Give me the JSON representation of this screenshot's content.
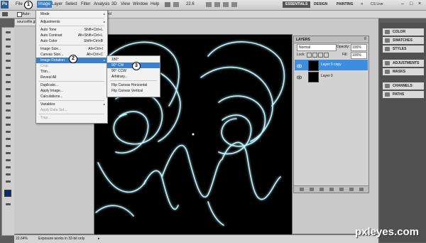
{
  "menubar": {
    "logo": "Ps",
    "items": [
      "File",
      "Image",
      "Layer",
      "Select",
      "Filter",
      "Analysis",
      "3D",
      "View",
      "Window",
      "Help"
    ],
    "zoom": "22.6",
    "workspaces": [
      "ESSENTIALS",
      "DESIGN",
      "PAINTING"
    ],
    "live": "CS Live"
  },
  "options": {
    "auto": "Auto-",
    "extra": "trol"
  },
  "doc": {
    "tab": "sourcefile.jp"
  },
  "steps": [
    "1",
    "2",
    "3"
  ],
  "image_menu": {
    "items": [
      {
        "label": "Mode",
        "shortcut": "",
        "arrow": true,
        "state": "normal"
      },
      {
        "label": "Adjustments",
        "shortcut": "",
        "arrow": true,
        "state": "normal"
      },
      {
        "label": "Auto Tone",
        "shortcut": "Shift+Ctrl+L",
        "arrow": false,
        "state": "normal"
      },
      {
        "label": "Auto Contrast",
        "shortcut": "Alt+Shift+Ctrl+L",
        "arrow": false,
        "state": "normal"
      },
      {
        "label": "Auto Color",
        "shortcut": "Shift+Ctrl+B",
        "arrow": false,
        "state": "normal"
      },
      {
        "label": "Image Size...",
        "shortcut": "Alt+Ctrl+I",
        "arrow": false,
        "state": "normal"
      },
      {
        "label": "Canvas Size...",
        "shortcut": "Alt+Ctrl+C",
        "arrow": false,
        "state": "normal"
      },
      {
        "label": "Image Rotation",
        "shortcut": "",
        "arrow": true,
        "state": "highlight"
      },
      {
        "label": "Crop",
        "shortcut": "",
        "arrow": false,
        "state": "disabled"
      },
      {
        "label": "Trim...",
        "shortcut": "",
        "arrow": false,
        "state": "normal"
      },
      {
        "label": "Reveal All",
        "shortcut": "",
        "arrow": false,
        "state": "normal"
      },
      {
        "label": "Duplicate...",
        "shortcut": "",
        "arrow": false,
        "state": "normal"
      },
      {
        "label": "Apply Image...",
        "shortcut": "",
        "arrow": false,
        "state": "normal"
      },
      {
        "label": "Calculations...",
        "shortcut": "",
        "arrow": false,
        "state": "normal"
      },
      {
        "label": "Variables",
        "shortcut": "",
        "arrow": true,
        "state": "normal"
      },
      {
        "label": "Apply Data Set...",
        "shortcut": "",
        "arrow": false,
        "state": "disabled"
      },
      {
        "label": "Trap...",
        "shortcut": "",
        "arrow": false,
        "state": "disabled"
      }
    ]
  },
  "rotation_menu": {
    "items": [
      {
        "label": "180°",
        "state": "normal"
      },
      {
        "label": "90° CW",
        "state": "highlight"
      },
      {
        "label": "90° CCW",
        "state": "normal"
      },
      {
        "label": "Arbitrary...",
        "state": "normal"
      },
      {
        "label": "Flip Canvas Horizontal",
        "state": "normal"
      },
      {
        "label": "Flip Canvas Vertical",
        "state": "normal"
      }
    ]
  },
  "layers_panel": {
    "title": "LAYERS",
    "blend_mode": "Normal",
    "opacity_label": "Opacity:",
    "opacity": "100%",
    "lock_label": "Lock:",
    "fill_label": "Fill:",
    "fill": "100%",
    "layers": [
      {
        "name": "Layer 0 copy",
        "selected": true
      },
      {
        "name": "Layer 0",
        "selected": false
      }
    ]
  },
  "side_panels": [
    "COLOR",
    "SWATCHES",
    "STYLES",
    "ADJUSTMENTS",
    "MASKS",
    "CHANNELS",
    "PATHS"
  ],
  "status": {
    "zoom": "22.64%",
    "message": "Exposure works in 32-bit only"
  },
  "watermark": "pxleyes.com",
  "colors": {
    "highlight": "#3c7fcb",
    "layer_selected": "#3d8ee0",
    "glow": "#bff3ff"
  }
}
